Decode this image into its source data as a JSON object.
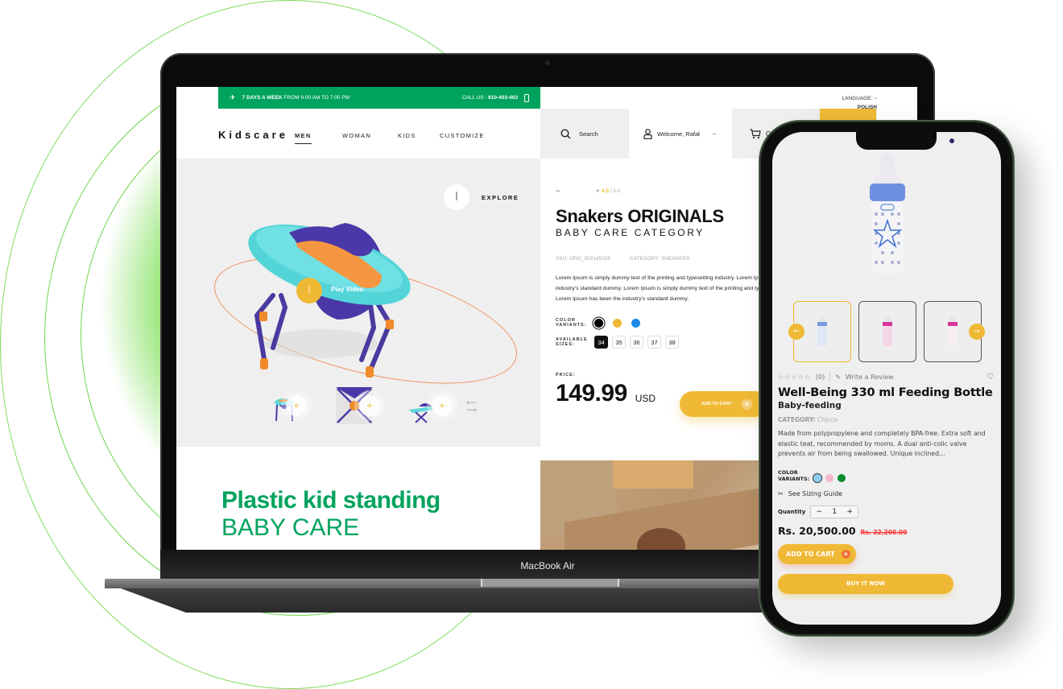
{
  "laptop": {
    "model_label": "MacBook Air",
    "topbar": {
      "schedule_bold": "7 DAYS A WEEK",
      "schedule_rest": "FROM 9:00 AM TO 7:00 PM",
      "call_label": "CALL US :",
      "phone": "610-403-403"
    },
    "language": {
      "label": "LANGUAGE:",
      "value": "POLISH"
    },
    "logo": "Kidscare",
    "nav": [
      {
        "label": "MEN",
        "active": true
      },
      {
        "label": "WOMAN"
      },
      {
        "label": "KIDS"
      },
      {
        "label": "CUSTOMIZE"
      }
    ],
    "search_label": "Search",
    "welcome_label": "Welcome, Rafał",
    "cart_label": "C",
    "hero": {
      "explore_label": "EXPLORE",
      "play_label": "Play Video"
    },
    "product": {
      "rating_value": "4.5",
      "rating_max": "/ 5.0",
      "title": "Snakers ORIGINALS",
      "subtitle": "BABY CARE CATEGORY",
      "sku": "SKU: ORG_002145156",
      "category": "CATEGORY: SNEAKERS",
      "description": [
        "Lorem Ipsum is simply dummy text of the printing and typesetting industry. Lorem Ipsum has been the",
        "industry's standard dummy. Lorem Ipsum is simply dummy text of the printing and typesetting",
        "Lorem Ipsum has been the industry's standard dummy."
      ],
      "color_label": "COLOR VARIANTS:",
      "colors": [
        "#000000",
        "#f0b935",
        "#1e88e5"
      ],
      "sizes_label": "AVAILABLE SIZES:",
      "sizes": [
        "34",
        "35",
        "36",
        "37",
        "38"
      ],
      "selected_size": "34",
      "price_label": "PRICE:",
      "price": "149.99",
      "currency": "USD",
      "add_to_cart": "ADD TO CART"
    },
    "banner": {
      "title": "Plastic kid standing",
      "subtitle": "BABY CARE"
    }
  },
  "phone": {
    "review_count": "(0)",
    "write_review": "Write a Review",
    "title": "Well-Being 330 ml Feeding Bottle",
    "subtitle": "Baby-feeding",
    "category_label": "CATEGORY:",
    "category_value": "Chicco",
    "description": "Made from polypropylene and completely BPA-free. Extra soft and elastic teat, recommended by moms. A dual anti-colic valve prevents air from being swallowed. Unique inclined...",
    "color_label_1": "COLOR",
    "color_label_2": "VARIANTS:",
    "colors": [
      "#8ecdf0",
      "#f5b8c8",
      "#0a8a2a"
    ],
    "sizing_guide": "See Sizing Guide",
    "quantity_label": "Quantity",
    "quantity": "1",
    "price": "Rs. 20,500.00",
    "old_price": "Rs. 22,200.00",
    "add_to_cart": "ADD TO CART",
    "buy_now": "BUY IT NOW"
  },
  "colors": {
    "brand_green": "#00a35e",
    "accent_yellow": "#f0b935"
  }
}
